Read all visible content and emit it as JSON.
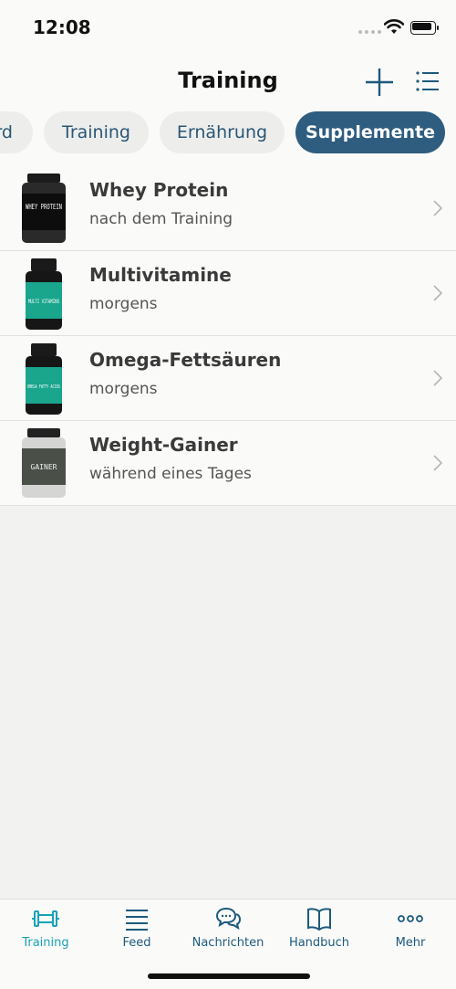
{
  "status": {
    "time": "12:08"
  },
  "header": {
    "title": "Training"
  },
  "tabs": [
    {
      "label": "Rekord"
    },
    {
      "label": "Training"
    },
    {
      "label": "Ernährung"
    },
    {
      "label": "Supplemente",
      "active": true
    }
  ],
  "supplements": [
    {
      "name": "Whey Protein",
      "timing": "nach dem Training",
      "label": "WHEY PROTEIN"
    },
    {
      "name": "Multivitamine",
      "timing": "morgens",
      "label": "MULTI VITAMINS"
    },
    {
      "name": "Omega-Fettsäuren",
      "timing": "morgens",
      "label": "OMEGA FATTY ACIDS"
    },
    {
      "name": "Weight-Gainer",
      "timing": "während eines Tages",
      "label": "GAINER"
    }
  ],
  "tabbar": [
    {
      "label": "Training",
      "icon": "dumbbell-icon",
      "active": true
    },
    {
      "label": "Feed",
      "icon": "feed-lines-icon"
    },
    {
      "label": "Nachrichten",
      "icon": "chat-bubbles-icon"
    },
    {
      "label": "Handbuch",
      "icon": "book-icon"
    },
    {
      "label": "Mehr",
      "icon": "more-dots-icon"
    }
  ],
  "colors": {
    "accent": "#2e5d80",
    "tab_active": "#17a2b8",
    "background": "#f2f3f1"
  }
}
